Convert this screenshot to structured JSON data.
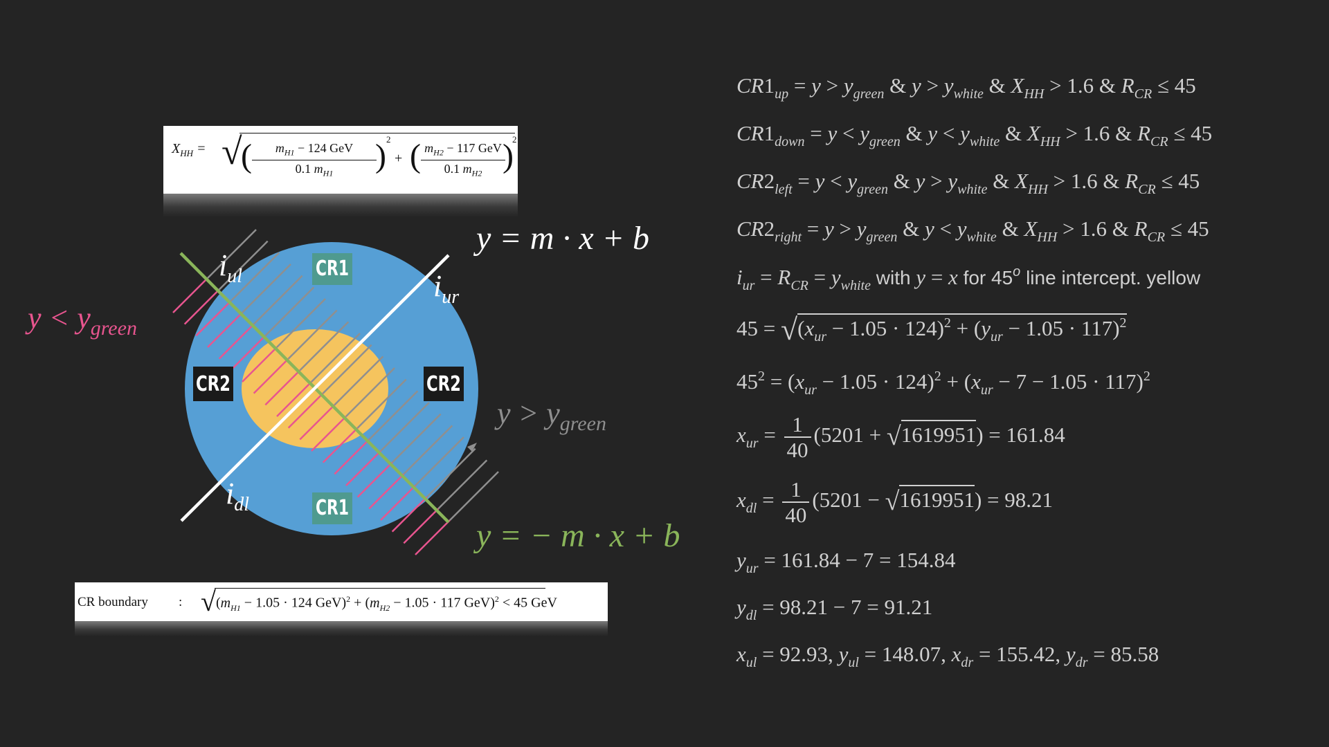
{
  "colors": {
    "background": "#242424",
    "circle": "#569fd5",
    "ellipse": "#f5c45e",
    "pink": "#e8558f",
    "green": "#8ab55a",
    "white": "#ffffff",
    "grey": "#8f8f8f"
  },
  "formula_xhh": "X_HH = √( ((m_H1 − 124 GeV)/(0.1 m_H1))² + ((m_H2 − 117 GeV)/(0.1 m_H2))² )",
  "formula_cr_boundary": {
    "label": "CR boundary",
    "colon": ":",
    "expression": "√((m_H1 − 1.05 · 124 GeV)² + (m_H2 − 1.05 · 117 GeV)²) < 45 GeV"
  },
  "diagram": {
    "labels": {
      "cr1_top": "CR1",
      "cr1_bottom": "CR1",
      "cr2_left": "CR2",
      "cr2_right": "CR2",
      "i_ul": "i_ul",
      "i_ur": "i_ur",
      "i_dl": "i_dl",
      "white_line_eq": "y = m · x + b",
      "green_line_eq": "y = − m · x + b",
      "pink_condition": "y < y_green",
      "grey_condition": "y > y_green"
    }
  },
  "equations": [
    "CR1_up = y > y_green & y > y_white & X_HH > 1.6 & R_CR ≤ 45",
    "CR1_down = y < y_green & y < y_white & X_HH > 1.6 & R_CR ≤ 45",
    "CR2_left = y < y_green & y > y_white & X_HH > 1.6 & R_CR ≤ 45",
    "CR2_right = y > y_green & y < y_white & X_HH > 1.6 & R_CR ≤ 45",
    "i_ur = R_CR = y_white with y = x for 45^o line intercept. yellow",
    "45 = √((x_ur − 1.05 · 124)² + (y_ur − 1.05 · 117)²)",
    "45² = (x_ur − 1.05 · 124)² + (x_ur − 7 − 1.05 · 117)²",
    "x_ur = 1/40 (5201 + √1619951) = 161.84",
    "x_dl = 1/40 (5201 − √1619951) = 98.21",
    "y_ur = 161.84 − 7 = 154.84",
    "y_dl = 98.21 − 7 = 91.21",
    "x_ul = 92.93, y_ul = 148.07, x_dr = 155.42, y_dr = 85.58"
  ]
}
